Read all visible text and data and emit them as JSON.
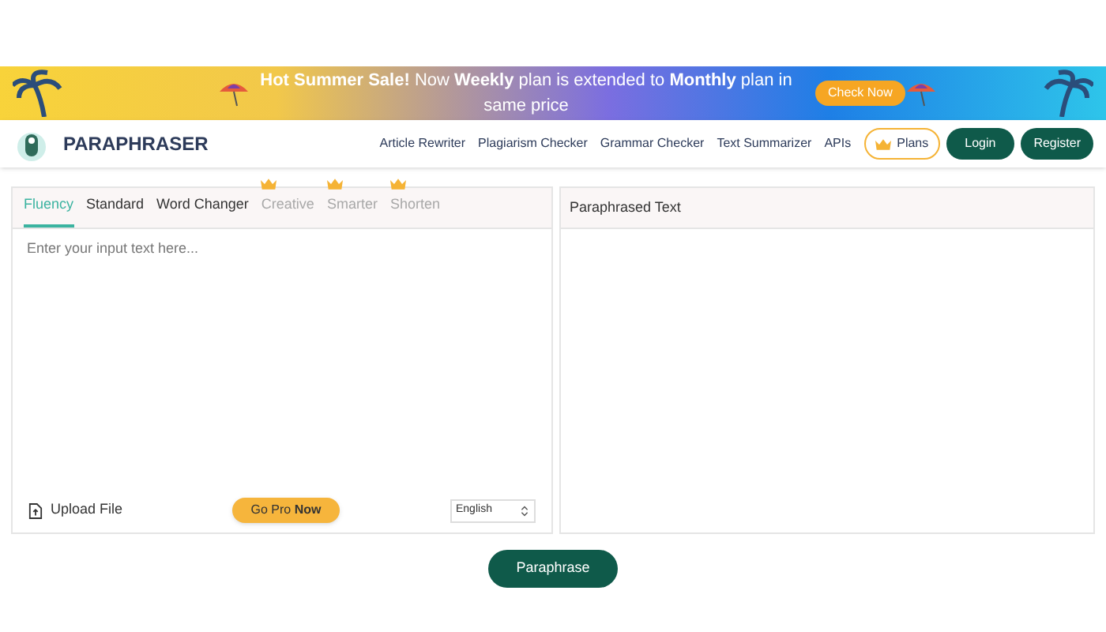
{
  "banner": {
    "text": "**Hot Summer Sale!** Now **Weekly** plan is extended to **Monthly** plan in same price",
    "cta": "Check Now"
  },
  "nav": {
    "brand": "PARAPHRASER",
    "links": [
      "Article Rewriter",
      "Plagiarism Checker",
      "Grammar Checker",
      "Text Summarizer",
      "APIs"
    ],
    "plans": "Plans",
    "login": "Login",
    "register": "Register"
  },
  "input_panel": {
    "tabs": [
      {
        "label": "Fluency",
        "selected": true,
        "locked": false
      },
      {
        "label": "Standard",
        "selected": false,
        "locked": false
      },
      {
        "label": "Word Changer",
        "selected": false,
        "locked": false
      },
      {
        "label": "Creative",
        "selected": false,
        "locked": true
      },
      {
        "label": "Smarter",
        "selected": false,
        "locked": true
      },
      {
        "label": "Shorten",
        "selected": false,
        "locked": true
      }
    ],
    "placeholder": "Enter your input text here...",
    "upload": "Upload File",
    "go_pro": "Go Pro **Now**",
    "language": "English"
  },
  "output_panel": {
    "title": "Paraphrased Text"
  },
  "action": {
    "label": "Paraphrase"
  }
}
